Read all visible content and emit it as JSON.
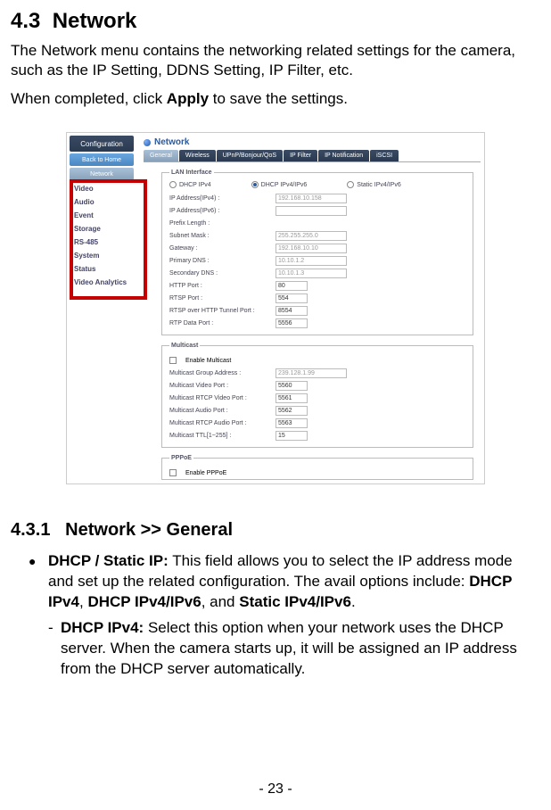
{
  "doc": {
    "section_no": "4.3",
    "section_title": "Network",
    "intro1": "The Network menu contains the networking related settings for the camera, such as the IP Setting, DDNS Setting, IP Filter, etc.",
    "intro2a": "When completed, click ",
    "intro2b": "Apply",
    "intro2c": " to save the settings.",
    "sub_no": "4.3.1",
    "sub_title": "Network >> General",
    "bullet_lead": "DHCP / Static IP:",
    "bullet_text": " This field allows you to select the IP address mode and set up the related configuration. The avail options include: ",
    "opt1": "DHCP IPv4",
    "opt2": "DHCP IPv4/IPv6",
    "opt3": "Static IPv4/IPv6",
    "and": ", and ",
    "comma_sp": ", ",
    "period": ".",
    "dash_lead": "DHCP IPv4:",
    "dash_text": " Select this option when your network uses the DHCP server. When the camera starts up, it will be assigned an IP address from the DHCP server automatically.",
    "page_num": "- 23 -"
  },
  "ss": {
    "sidebar": {
      "config": "Configuration",
      "back": "Back to Home",
      "network": "Network",
      "items": [
        "Video",
        "Audio",
        "Event",
        "Storage",
        "RS-485",
        "System",
        "Status",
        "Video Analytics"
      ]
    },
    "title": "Network",
    "tabs": [
      "General",
      "Wireless",
      "UPnP/Bonjour/QoS",
      "IP Filter",
      "IP Notification",
      "iSCSI"
    ],
    "lan": {
      "legend": "LAN Interface",
      "radios": [
        "DHCP IPv4",
        "DHCP IPv4/IPv6",
        "Static IPv4/IPv6"
      ],
      "rows": [
        {
          "label": "IP Address(IPv4) :",
          "val": "192.168.10.158"
        },
        {
          "label": "IP Address(IPv6) :",
          "val": ""
        },
        {
          "label": "Prefix Length :",
          "val": ""
        },
        {
          "label": "Subnet Mask :",
          "val": "255.255.255.0"
        },
        {
          "label": "Gateway :",
          "val": "192.168.10.10"
        },
        {
          "label": "Primary DNS :",
          "val": "10.10.1.2"
        },
        {
          "label": "Secondary DNS :",
          "val": "10.10.1.3"
        },
        {
          "label": "HTTP Port :",
          "val": "80",
          "sm": true
        },
        {
          "label": "RTSP Port :",
          "val": "554",
          "sm": true
        },
        {
          "label": "RTSP over HTTP Tunnel Port :",
          "val": "8554",
          "sm": true
        },
        {
          "label": "RTP Data Port :",
          "val": "5556",
          "sm": true
        }
      ]
    },
    "multi": {
      "legend": "Multicast",
      "enable": "Enable Multicast",
      "rows": [
        {
          "label": "Multicast Group Address :",
          "val": "239.128.1.99"
        },
        {
          "label": "Multicast Video Port :",
          "val": "5560",
          "sm": true
        },
        {
          "label": "Multicast RTCP Video Port :",
          "val": "5561",
          "sm": true
        },
        {
          "label": "Multicast Audio Port :",
          "val": "5562",
          "sm": true
        },
        {
          "label": "Multicast RTCP Audio Port :",
          "val": "5563",
          "sm": true
        },
        {
          "label": "Multicast TTL[1~255] :",
          "val": "15",
          "sm": true
        }
      ]
    },
    "pppoe": {
      "legend": "PPPoE",
      "enable": "Enable PPPoE"
    }
  }
}
